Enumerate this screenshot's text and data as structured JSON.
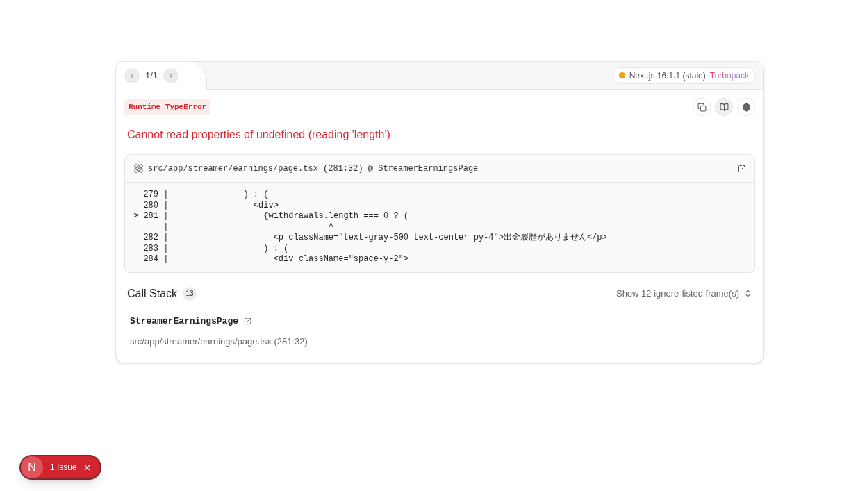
{
  "pager": {
    "text": "1/1"
  },
  "version_badge": {
    "text": "Next.js 16.1.1 (stale)",
    "bundler": "Turbopack",
    "color": "#f59e0b"
  },
  "error": {
    "type": "Runtime TypeError",
    "message": "Cannot read properties of undefined (reading 'length')"
  },
  "code_frame": {
    "file": "src/app/streamer/earnings/page.tsx (281:32) @ StreamerEarningsPage",
    "lines": [
      "  279 |               ) : (",
      "  280 |                 <div>",
      "> 281 |                   {withdrawals.length === 0 ? (",
      "      |                                ^",
      "  282 |                     <p className=\"text-gray-500 text-center py-4\">出金履歴がありません</p>",
      "  283 |                   ) : (",
      "  284 |                     <div className=\"space-y-2\">"
    ]
  },
  "call_stack": {
    "title": "Call Stack",
    "count": "13",
    "toggle": "Show 12 ignore-listed frame(s)",
    "frames": [
      {
        "name": "StreamerEarningsPage",
        "location": "src/app/streamer/earnings/page.tsx (281:32)"
      }
    ]
  },
  "issue_badge": {
    "logo": "N",
    "text": "1 Issue"
  }
}
